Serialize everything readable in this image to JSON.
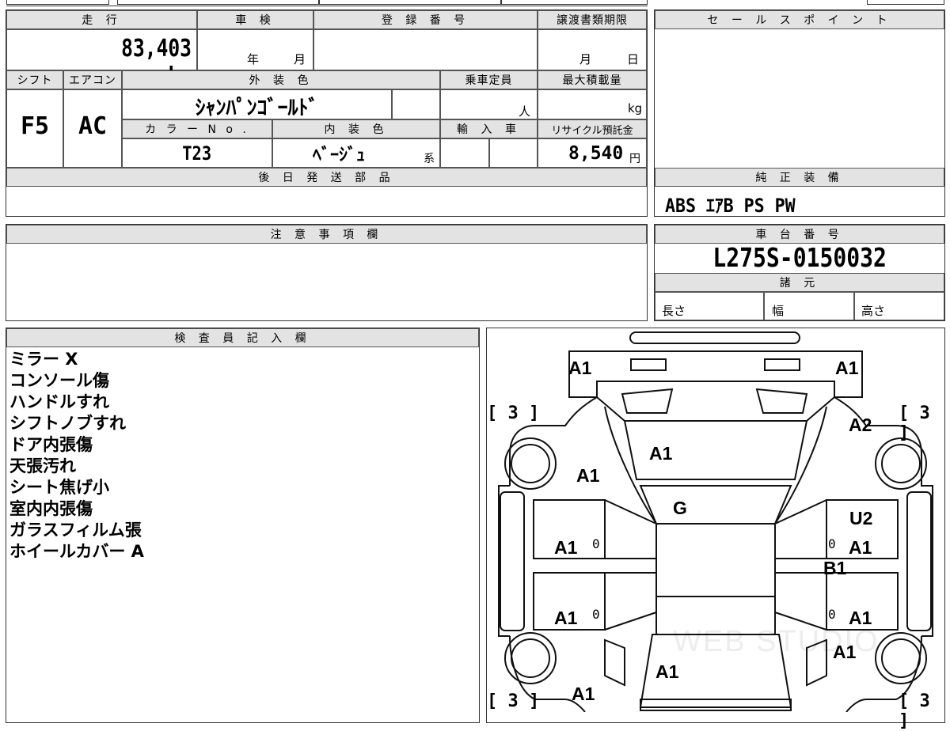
{
  "header": {
    "mileage_label": "走 行",
    "inspection_label": "車 検",
    "registration_label": "登 録 番 号",
    "transfer_label": "譲渡書類期限",
    "sales_point_label": "セ ー ル ス ポ イ ン ト",
    "mileage_value": "83,403 km",
    "inspection_year": "年",
    "inspection_month": "月",
    "transfer_month": "月",
    "transfer_day": "日"
  },
  "specs": {
    "shift_label": "シフト",
    "aircon_label": "エアコン",
    "exterior_label": "外 装 色",
    "capacity_label": "乗車定員",
    "max_load_label": "最大積載量",
    "shift_value": "F5",
    "aircon_value": "AC",
    "exterior_value": "ｼｬﾝﾊﾟﾝｺﾞｰﾙﾄﾞ",
    "capacity_unit": "人",
    "max_load_unit": "kg",
    "color_no_label": "カ ラ ー N o .",
    "interior_label": "内 装 色",
    "import_label": "輸 入 車",
    "recycle_label": "リサイクル預託金",
    "color_no_value": "T23",
    "interior_value": "ﾍﾞｰｼﾞｭ",
    "interior_suffix": "系",
    "recycle_value": "8,540",
    "recycle_unit": "円"
  },
  "later_parts_label": "後 日 発 送 部 品",
  "standard_equipment": {
    "label": "純 正 装 備",
    "value": "ABS ｴｱB PS PW"
  },
  "notes_label": "注 意 事 項 欄",
  "chassis": {
    "label": "車 台 番 号",
    "value": "L275S-0150032",
    "specs_label": "諸 元",
    "length_label": "長さ",
    "width_label": "幅",
    "height_label": "高さ"
  },
  "inspector": {
    "label": "検 査 員 記 入 欄",
    "lines": [
      "ミラー X",
      "コンソール傷",
      "ハンドルすれ",
      "シフトノブすれ",
      "ドア内張傷",
      "天張汚れ",
      "シート焦げ小",
      "室内内張傷",
      "ガラスフィルム張",
      "ホイールカバー A"
    ]
  },
  "diagram": {
    "marks": {
      "front_left": "A1",
      "front_right": "A1",
      "hood": "A1",
      "left_fender": "A1",
      "right_fender": "A2",
      "windshield": "G",
      "right_front_door_top": "U2",
      "left_front_door": "A1",
      "right_front_door": "A1",
      "right_sill": "B1",
      "left_rear_door": "A1",
      "right_rear_door": "A1",
      "right_rear_quarter": "A1",
      "roof_rear": "A1",
      "left_rear": "A1"
    },
    "tire_marks": [
      "[ 3 ]",
      "[ 3 ]",
      "[ 3 ]",
      "[ 3 ]"
    ],
    "zero_marks": [
      "0",
      "0",
      "0",
      "0"
    ],
    "watermark": "WEB STUDIO"
  }
}
